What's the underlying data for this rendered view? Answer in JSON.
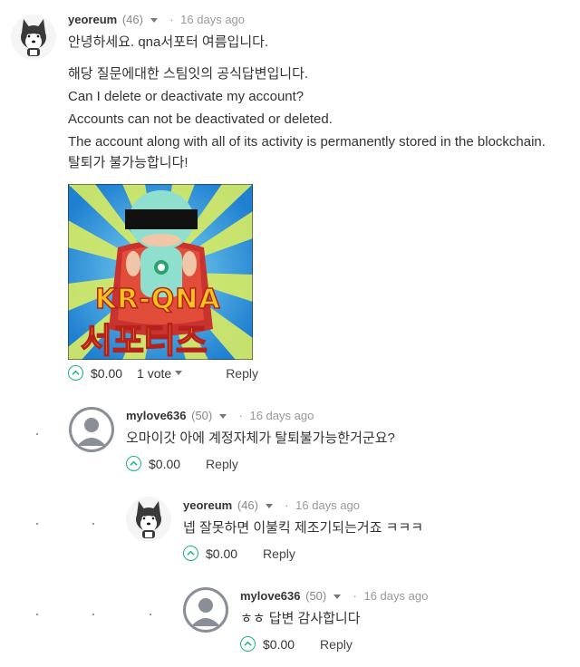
{
  "comments": [
    {
      "author": "yeoreum",
      "reputation": "(46)",
      "date": "16 days ago",
      "lines": [
        "안녕하세요. qna서포터 여름입니다.",
        "해당 질문에대한 스팀잇의 공식답변입니다.",
        "Can I delete or deactivate my account?",
        "Accounts can not be deactivated or deleted.",
        "The account along with all of its activity is permanently stored in the blockchain.",
        "탈퇴가 불가능합니다!"
      ],
      "image_caption_top": "KR-QNA",
      "image_caption_bottom": "서포터즈",
      "payout": "$0.00",
      "votes": "1 vote",
      "reply": "Reply"
    },
    {
      "author": "mylove636",
      "reputation": "(50)",
      "date": "16 days ago",
      "lines": [
        "오마이갓 아에 계정자체가 탈퇴불가능한거군요?"
      ],
      "payout": "$0.00",
      "reply": "Reply"
    },
    {
      "author": "yeoreum",
      "reputation": "(46)",
      "date": "16 days ago",
      "lines": [
        "넵 잘못하면 이불킥 제조기되는거죠 ㅋㅋㅋ"
      ],
      "payout": "$0.00",
      "reply": "Reply"
    },
    {
      "author": "mylove636",
      "reputation": "(50)",
      "date": "16 days ago",
      "lines": [
        "ㅎㅎ 답변 감사합니다"
      ],
      "payout": "$0.00",
      "reply": "Reply"
    }
  ],
  "icons": {
    "upvote": "upvote-chevron-icon",
    "dropdown": "caret-down-icon",
    "default_avatar": "default-user-icon",
    "husky_avatar": "husky-dog-icon"
  },
  "colors": {
    "accent": "#1ab285",
    "poster_sky": "#1f7fd1",
    "poster_ray": "#d8ec63",
    "poster_text": "#f2c51b"
  }
}
